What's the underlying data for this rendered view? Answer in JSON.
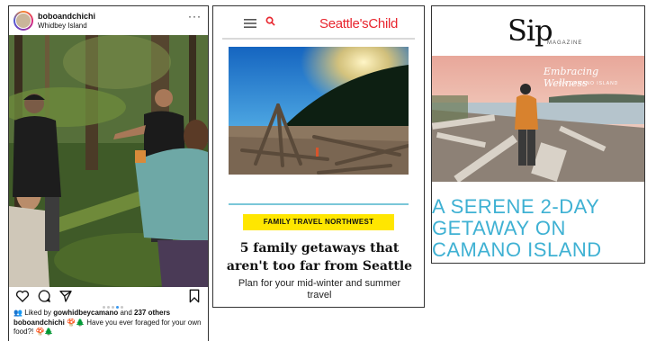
{
  "instagram": {
    "username": "boboandchichi",
    "location": "Whidbey Island",
    "more_icon": "···",
    "icons": [
      "heart-icon",
      "comment-icon",
      "share-icon",
      "bookmark-icon"
    ],
    "carousel_dots": 5,
    "carousel_active_index": 3,
    "likes_prefix": "Liked by ",
    "likes_user": "gowhidbeycamano",
    "likes_middle": " and ",
    "likes_count": "237 others",
    "caption_user": "boboandchichi",
    "caption_text": " 🍄🌲 Have you ever foraged for your own food?! 🍄🌲"
  },
  "seattles_child": {
    "logo": "Seattle'sChild",
    "menu_icon": "hamburger-menu-icon",
    "search_icon": "search-icon",
    "tag": "FAMILY TRAVEL NORTHWEST",
    "headline": "5 family getaways that aren't too far from Seattle",
    "subhead": "Plan for your mid-winter and summer travel"
  },
  "sip": {
    "logo": "Sip",
    "logo_sub": "MAGAZINE",
    "overlay_title": "Embracing Wellness",
    "overlay_sub": "ON CAMANO ISLAND",
    "headline": "A SERENE 2-DAY GETAWAY ON CAMANO ISLAND"
  },
  "colors": {
    "seattles_child_red": "#e8262f",
    "tag_yellow": "#ffe600",
    "sip_blue": "#3fb1d3",
    "instagram_blue": "#3897f0"
  }
}
